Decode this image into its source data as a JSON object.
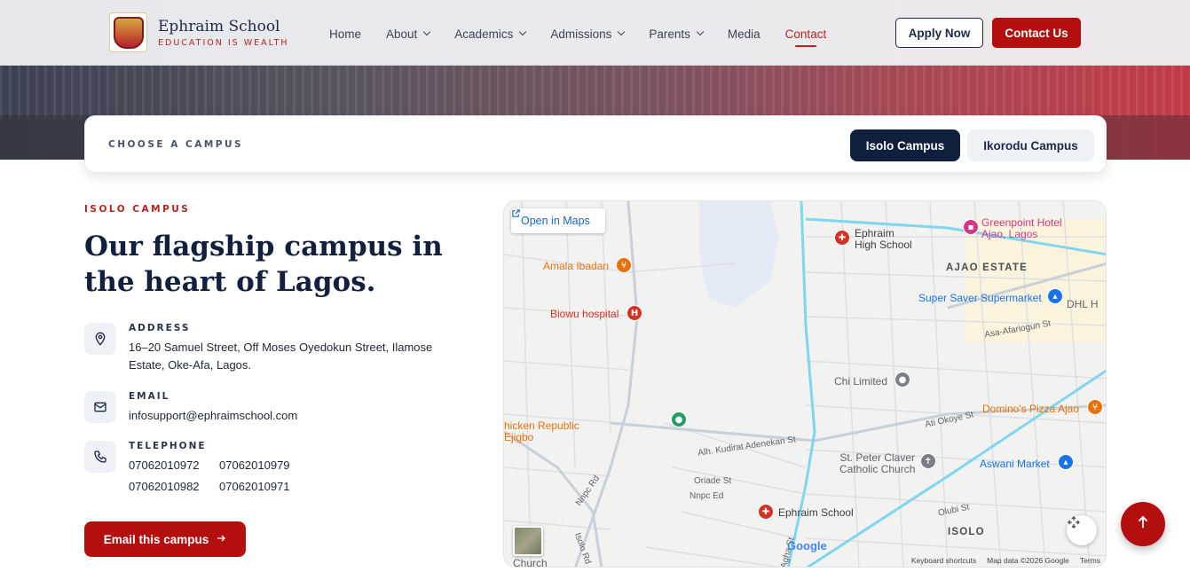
{
  "brand": {
    "name": "Ephraim School",
    "tagline": "EDUCATION IS WEALTH"
  },
  "nav": {
    "items": [
      {
        "label": "Home",
        "dropdown": false
      },
      {
        "label": "About",
        "dropdown": true
      },
      {
        "label": "Academics",
        "dropdown": true
      },
      {
        "label": "Admissions",
        "dropdown": true
      },
      {
        "label": "Parents",
        "dropdown": true
      },
      {
        "label": "Media",
        "dropdown": false
      },
      {
        "label": "Contact",
        "dropdown": false,
        "active": true
      }
    ],
    "apply_label": "Apply Now",
    "contact_label": "Contact Us"
  },
  "chooser": {
    "label": "CHOOSE A CAMPUS",
    "campuses": [
      "Isolo Campus",
      "Ikorodu Campus"
    ],
    "selected": "Isolo Campus"
  },
  "campus": {
    "eyebrow": "ISOLO CAMPUS",
    "headline": "Our flagship campus in the heart of Lagos.",
    "address_label": "ADDRESS",
    "address_line1": "16–20 Samuel Street, Off Moses Oyedokun Street, Ilamose",
    "address_line2": "Estate, Oke-Afa, Lagos.",
    "email_label": "EMAIL",
    "email": "infosupport@ephraimschool.com",
    "telephone_label": "TELEPHONE",
    "phones": [
      "07062010972",
      "07062010979",
      "07062010982",
      "07062010971"
    ],
    "email_button": "Email this campus"
  },
  "map": {
    "open_label": "Open in Maps",
    "labels": {
      "ephraim_high": "Ephraim\nHigh School",
      "greenpoint": "Greenpoint Hotel\nAjao, Lagos",
      "amala": "Amala Ibadan",
      "ajao_estate": "AJAO ESTATE",
      "super_saver": "Super Saver Supermarket",
      "dhl": "DHL H",
      "biowu": "Biowu hospital",
      "asa_afariogun": "Asa-Afariogun St",
      "chi_limited": "Chi Limited",
      "chicken_republic": "hicken Republic\nEjigbo",
      "ati_okoye": "Ati Okoye St",
      "dominos": "Domino's Pizza Ajao",
      "kudirat": "Alh. Kudirat Adenekan St",
      "st_peter": "St. Peter Claver\nCatholic Church",
      "aswani": "Aswani Market",
      "oriade": "Oriade St",
      "npc_ed": "Nnpc Ed",
      "npc_rd": "Nnpc Rd",
      "ephraim_school": "Ephraim School",
      "olubi": "Olubi St",
      "isolo": "ISOLO",
      "isolo_rd": "Isolo Rd",
      "church": "Church",
      "agha": "Agha St"
    },
    "google": "Google",
    "footer": [
      "Keyboard shortcuts",
      "Map data ©2026 Google",
      "Terms"
    ]
  },
  "colors": {
    "brand_red": "#b30f0f",
    "navy": "#0f1f3d",
    "accent_red_text": "#b3261e"
  }
}
